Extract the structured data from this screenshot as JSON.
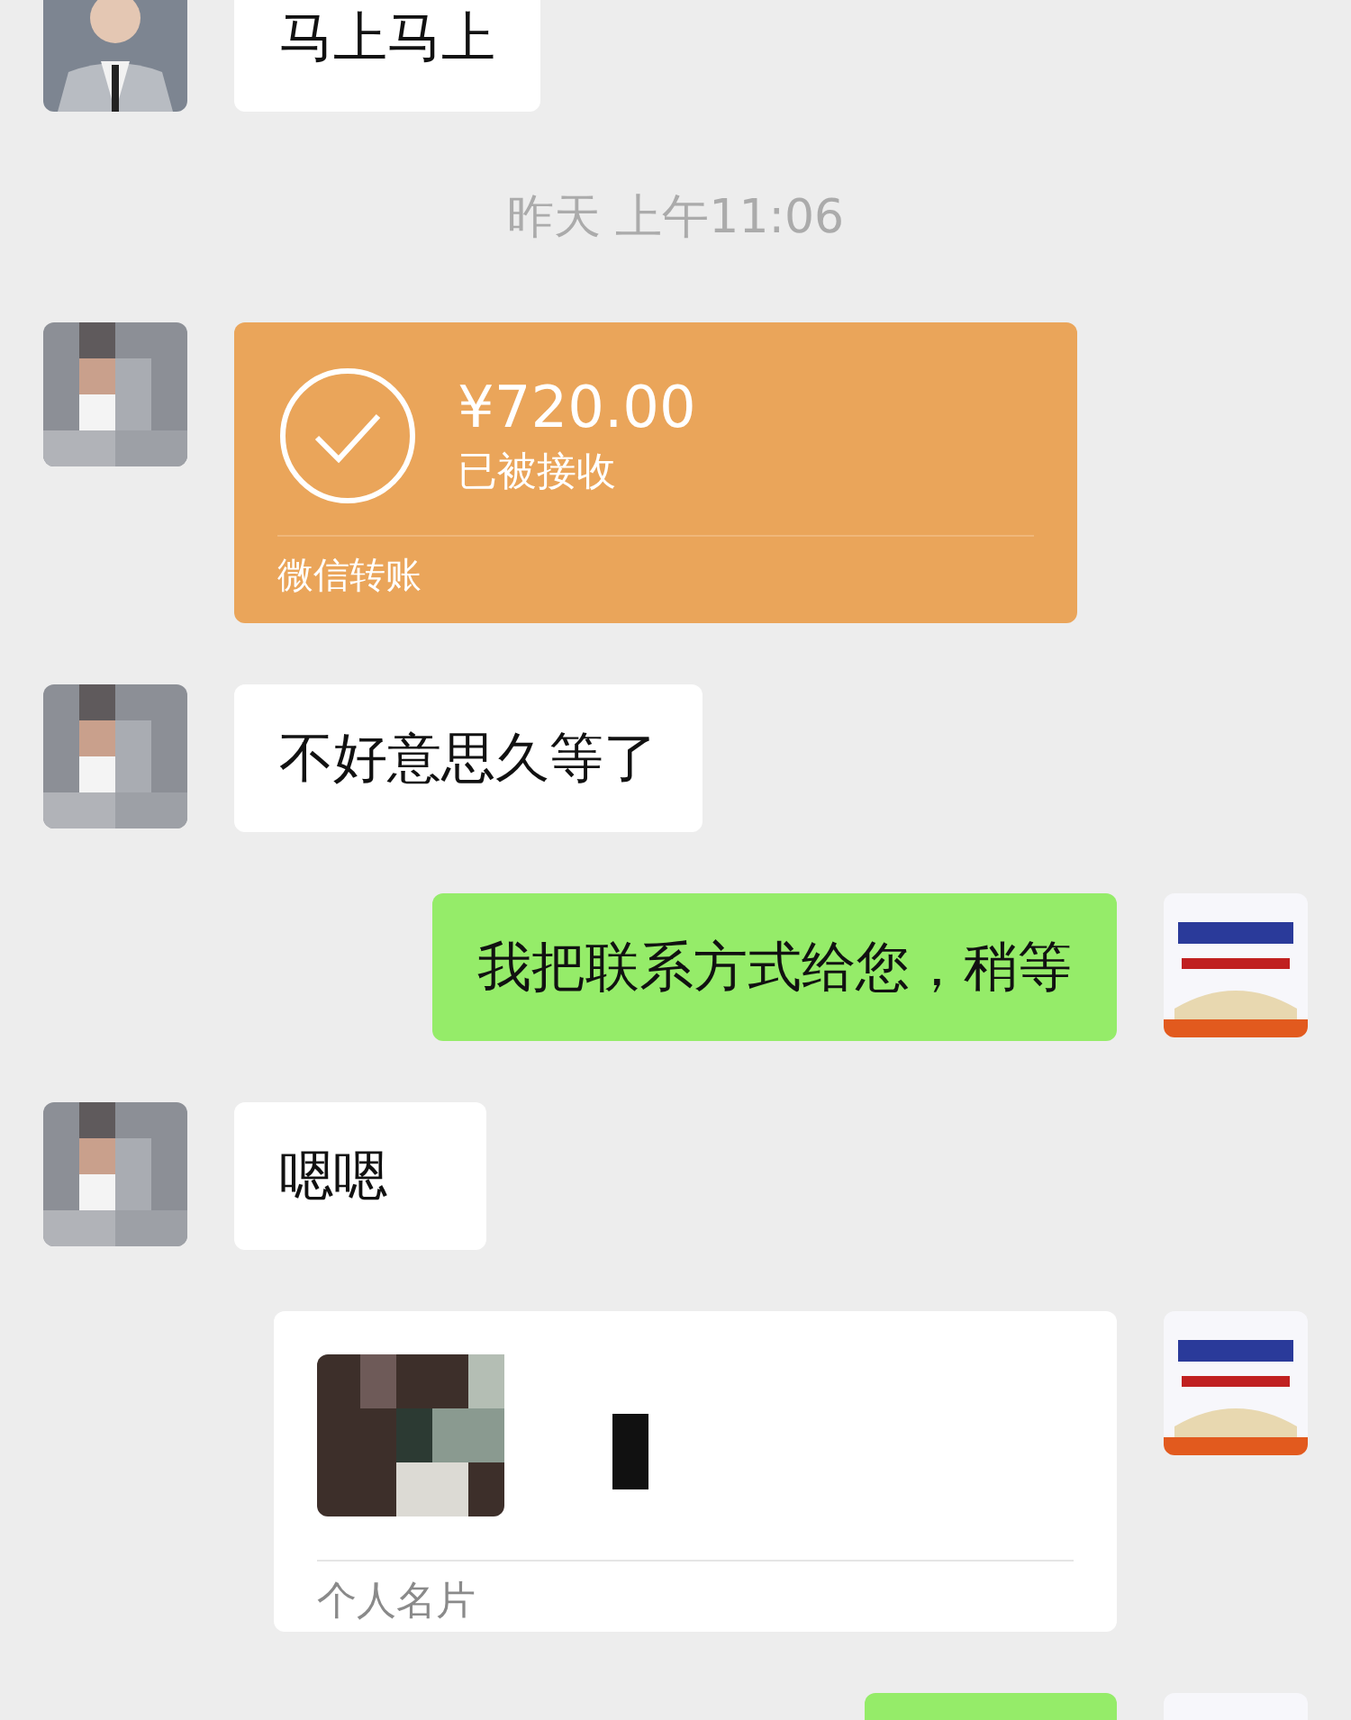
{
  "messages": [
    {
      "kind": "text",
      "outgoing": false,
      "text": "马上马上"
    },
    {
      "kind": "time",
      "text": "昨天 上午11:06"
    },
    {
      "kind": "transfer",
      "outgoing": false,
      "amount": "¥720.00",
      "status": "已被接收",
      "footer": "微信转账"
    },
    {
      "kind": "text",
      "outgoing": false,
      "text": "不好意思久等了"
    },
    {
      "kind": "text",
      "outgoing": true,
      "text": "我把联系方式给您，稍等"
    },
    {
      "kind": "text",
      "outgoing": false,
      "text": "嗯嗯"
    },
    {
      "kind": "card",
      "outgoing": true,
      "footer": "个人名片"
    },
    {
      "kind": "text",
      "outgoing": true
    }
  ]
}
